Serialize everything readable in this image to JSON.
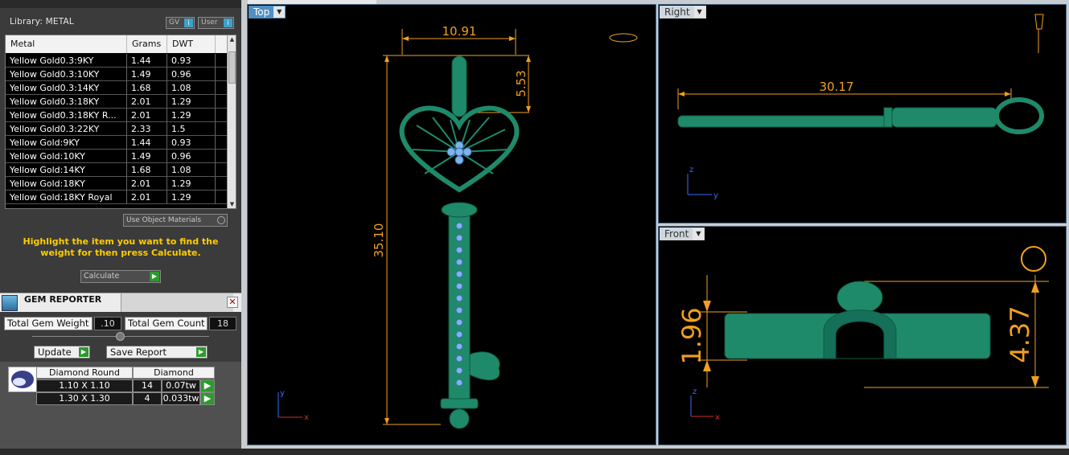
{
  "library": {
    "header": "Library: METAL",
    "toggles": [
      {
        "label": "GV"
      },
      {
        "label": "User"
      }
    ],
    "columns": [
      "Metal",
      "Grams",
      "DWT"
    ],
    "rows": [
      {
        "metal": "Yellow Gold0.3:9KY",
        "grams": "1.44",
        "dwt": "0.93"
      },
      {
        "metal": "Yellow Gold0.3:10KY",
        "grams": "1.49",
        "dwt": "0.96"
      },
      {
        "metal": "Yellow Gold0.3:14KY",
        "grams": "1.68",
        "dwt": "1.08"
      },
      {
        "metal": "Yellow Gold0.3:18KY",
        "grams": "2.01",
        "dwt": "1.29"
      },
      {
        "metal": "Yellow Gold0.3:18KY R...",
        "grams": "2.01",
        "dwt": "1.29"
      },
      {
        "metal": "Yellow Gold0.3:22KY",
        "grams": "2.33",
        "dwt": "1.5"
      },
      {
        "metal": "Yellow Gold:9KY",
        "grams": "1.44",
        "dwt": "0.93"
      },
      {
        "metal": "Yellow Gold:10KY",
        "grams": "1.49",
        "dwt": "0.96"
      },
      {
        "metal": "Yellow Gold:14KY",
        "grams": "1.68",
        "dwt": "1.08"
      },
      {
        "metal": "Yellow Gold:18KY",
        "grams": "2.01",
        "dwt": "1.29"
      },
      {
        "metal": "Yellow Gold:18KY Royal",
        "grams": "2.01",
        "dwt": "1.29"
      }
    ],
    "use_object_materials": "Use Object Materials",
    "hint": "Highlight the item you want to find the weight for then press Calculate.",
    "calculate_label": "Calculate"
  },
  "gem_reporter": {
    "title": "GEM REPORTER",
    "close": "✕",
    "total_gem_weight_label": "Total Gem Weight",
    "total_gem_weight": ".10",
    "total_gem_count_label": "Total Gem Count",
    "total_gem_count": "18",
    "update_label": "Update",
    "save_report_label": "Save Report",
    "gem_headers": [
      "Diamond Round",
      "Diamond"
    ],
    "gems": [
      {
        "size": "1.10 X 1.10",
        "count": "14",
        "weight": "0.07tw"
      },
      {
        "size": "1.30 X 1.30",
        "count": "4",
        "weight": "0.033tw"
      }
    ]
  },
  "viewports": {
    "top": {
      "label": "Top",
      "dims": {
        "width": "10.91",
        "height_top": "5.53",
        "length": "35.10"
      },
      "axis_x": "x",
      "axis_y": "y"
    },
    "right": {
      "label": "Right",
      "dims": {
        "length": "30.17"
      },
      "axis_z": "z",
      "axis_y": "y"
    },
    "front": {
      "label": "Front",
      "dims": {
        "left": "1.96",
        "right": "4.37"
      },
      "axis_z": "z",
      "axis_x": "x"
    }
  },
  "colors": {
    "accent": "#4f8fc4",
    "dimension": "#f0a020",
    "model": "#1f8a6a",
    "hint": "#ffcc00"
  }
}
